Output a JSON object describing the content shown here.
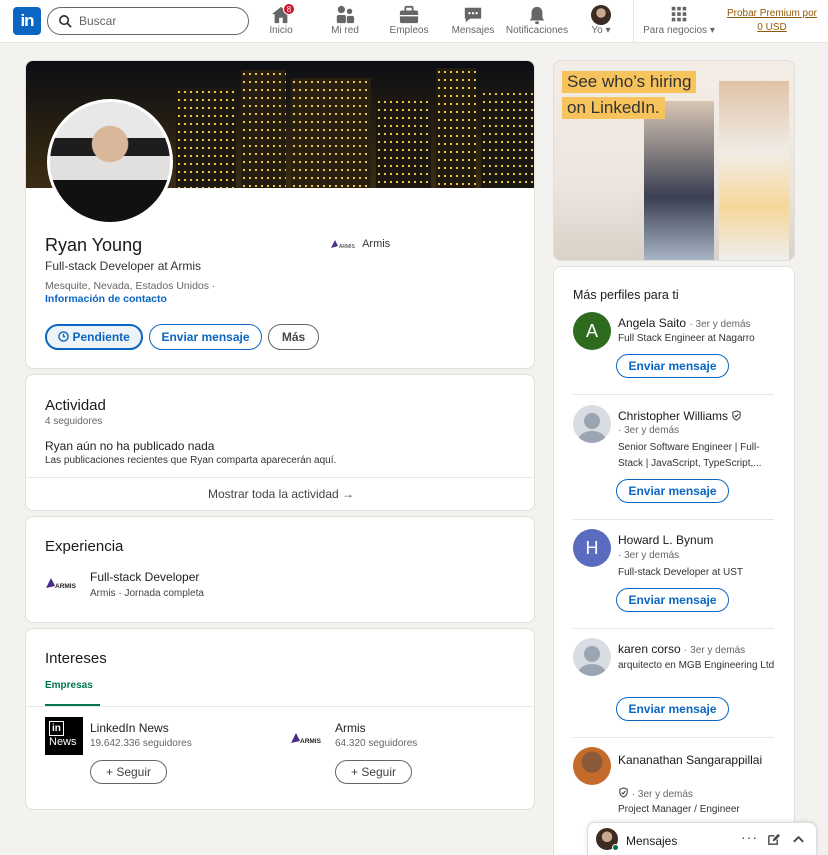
{
  "header": {
    "logo": "in",
    "search_placeholder": "Buscar",
    "nav": [
      {
        "label": "Inicio",
        "icon": "home-icon",
        "badge": "8"
      },
      {
        "label": "Mi red",
        "icon": "network-icon"
      },
      {
        "label": "Empleos",
        "icon": "briefcase-icon"
      },
      {
        "label": "Mensajes",
        "icon": "messaging-icon"
      },
      {
        "label": "Notificaciones",
        "icon": "bell-icon"
      },
      {
        "label": "Yo",
        "icon": "me-avatar"
      },
      {
        "label": "Para negocios",
        "icon": "grid-icon"
      }
    ],
    "premium": "Probar Premium por 0 USD"
  },
  "profile": {
    "name": "Ryan Young",
    "headline": "Full-stack Developer at Armis",
    "location": "Mesquite, Nevada, Estados Unidos ·",
    "contact": "Información de contacto",
    "company": "Armis",
    "buttons": {
      "pending": "Pendiente",
      "message": "Enviar mensaje",
      "more": "Más"
    }
  },
  "activity": {
    "title": "Actividad",
    "followers": "4 seguidores",
    "empty_title": "Ryan aún no ha publicado nada",
    "empty_desc": "Las publicaciones recientes que Ryan comparta aparecerán aquí.",
    "show_all": "Mostrar toda la actividad →"
  },
  "experience": {
    "title": "Experiencia",
    "role": "Full-stack Developer",
    "detail": "Armis · Jornada completa",
    "logo_text": "ARMIS"
  },
  "interests": {
    "title": "Intereses",
    "tab": "Empresas",
    "items": [
      {
        "name": "LinkedIn News",
        "followers": "19.642.336 seguidores",
        "button": "+ Seguir",
        "logo_line1": "in",
        "logo_line2": "News"
      },
      {
        "name": "Armis",
        "followers": "64.320 seguidores",
        "button": "+ Seguir",
        "logo_line1": "ARMIS"
      }
    ]
  },
  "ad": {
    "line1": "See who’s hiring",
    "line2": "on LinkedIn."
  },
  "sidebar": {
    "title": "Más perfiles para ti",
    "people": [
      {
        "initial": "A",
        "name": "Angela Saito",
        "degree": "· 3er y demás",
        "role": "Full Stack Engineer at Nagarro",
        "button": "Enviar mensaje",
        "color": "#2e6b1f"
      },
      {
        "initial": "",
        "name": "Christopher Williams",
        "degree": "· 3er y demás",
        "role": "Senior Software Engineer | Full-Stack | JavaScript, TypeScript,...",
        "button": "Enviar mensaje",
        "color": "#d8dde3"
      },
      {
        "initial": "H",
        "name": "Howard L. Bynum",
        "degree": "· 3er y demás",
        "role": "Full-stack Developer at UST",
        "button": "Enviar mensaje",
        "color": "#5b6bc0"
      },
      {
        "initial": "",
        "name": "karen corso",
        "degree": "· 3er y demás",
        "role": "arquitecto en MGB Engineering Ltd",
        "button": "Enviar mensaje",
        "color": "#d8dde3"
      },
      {
        "initial": "",
        "name": "Kananathan Sangarappillai",
        "degree": "· 3er y demás",
        "role": "Project Manager / Engineer",
        "color": "#c46a2a"
      }
    ]
  },
  "messaging": {
    "label": "Mensajes"
  }
}
